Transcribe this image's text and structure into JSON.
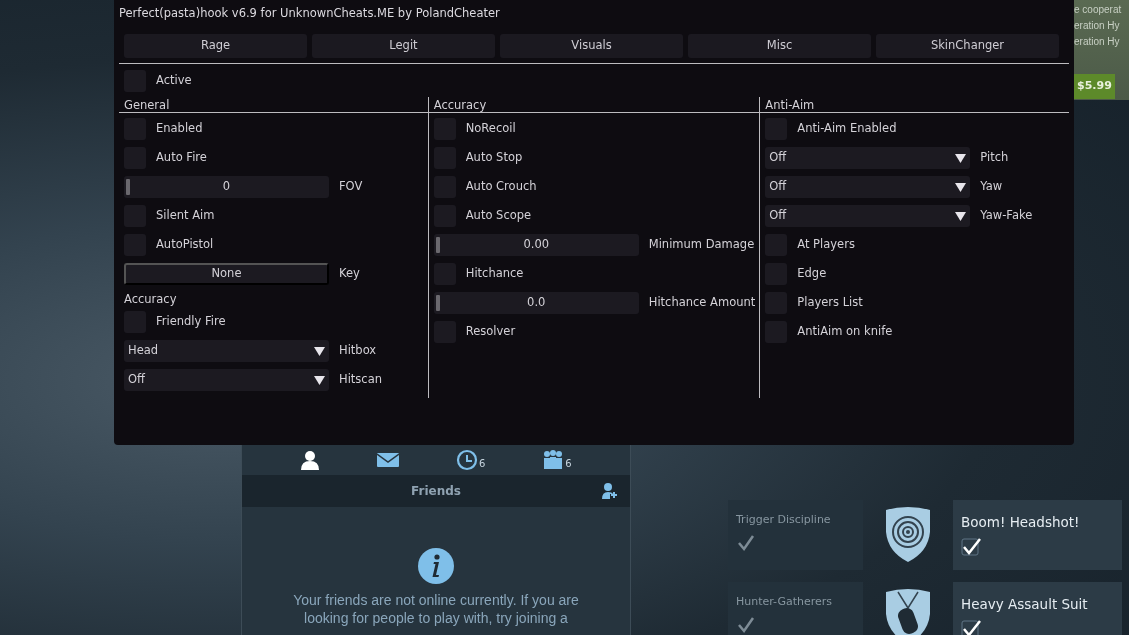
{
  "store": {
    "lines": [
      "e cooperat",
      "eration Hy",
      "eration Hy"
    ],
    "price": "$5.99"
  },
  "friends": {
    "icons": [
      {
        "kind": "person"
      },
      {
        "kind": "mail"
      },
      {
        "kind": "clock",
        "count": "6"
      },
      {
        "kind": "group",
        "count": "6"
      }
    ],
    "heading": "Friends",
    "message": [
      "Your friends are not online currently.  If you are",
      "looking for people to play with, try joining a"
    ]
  },
  "achievements": [
    {
      "title": "Trigger Discipline",
      "kind": "dim"
    },
    {
      "title": "Boom! Headshot!",
      "kind": "bright"
    },
    {
      "title": "Hunter-Gatherers",
      "kind": "dim"
    },
    {
      "title": "Heavy Assault Suit",
      "kind": "bright"
    }
  ],
  "window": {
    "title": "Perfect(pasta)hook v6.9 for UnknownCheats.ME by PolandCheater"
  },
  "tabs": [
    {
      "label": "Rage",
      "selected": false
    },
    {
      "label": "Legit",
      "selected": false
    },
    {
      "label": "Visuals",
      "selected": false
    },
    {
      "label": "Misc",
      "selected": false
    },
    {
      "label": "SkinChanger",
      "selected": false
    }
  ],
  "active": {
    "label": "Active",
    "checked": false
  },
  "columns": [
    {
      "heading": "General",
      "items": [
        {
          "kind": "checkbox",
          "label": "Enabled",
          "checked": false
        },
        {
          "kind": "checkbox",
          "label": "Auto Fire",
          "checked": false
        },
        {
          "kind": "slider",
          "reading": "0",
          "label": "FOV",
          "level": 0
        },
        {
          "kind": "checkbox",
          "label": "Silent Aim",
          "checked": false
        },
        {
          "kind": "checkbox",
          "label": "AutoPistol",
          "checked": false
        },
        {
          "kind": "keybind",
          "key": "None",
          "label": "Key"
        },
        {
          "kind": "subheading",
          "label": "Accuracy"
        },
        {
          "kind": "checkbox",
          "label": "Friendly Fire",
          "checked": false
        },
        {
          "kind": "dropdown",
          "option": "Head",
          "label": "Hitbox"
        },
        {
          "kind": "dropdown",
          "option": "Off",
          "label": "Hitscan"
        }
      ]
    },
    {
      "heading": "Accuracy",
      "items": [
        {
          "kind": "checkbox",
          "label": "NoRecoil",
          "checked": false
        },
        {
          "kind": "checkbox",
          "label": "Auto Stop",
          "checked": false
        },
        {
          "kind": "checkbox",
          "label": "Auto Crouch",
          "checked": false
        },
        {
          "kind": "checkbox",
          "label": "Auto Scope",
          "checked": false
        },
        {
          "kind": "slider",
          "reading": "0.00",
          "label": "Minimum Damage",
          "level": 0
        },
        {
          "kind": "checkbox",
          "label": "Hitchance",
          "checked": false
        },
        {
          "kind": "slider",
          "reading": "0.0",
          "label": "Hitchance Amount",
          "level": 0
        },
        {
          "kind": "checkbox",
          "label": "Resolver",
          "checked": false
        }
      ]
    },
    {
      "heading": "Anti-Aim",
      "items": [
        {
          "kind": "checkbox",
          "label": "Anti-Aim Enabled",
          "checked": false
        },
        {
          "kind": "dropdown",
          "option": "Off",
          "label": "Pitch"
        },
        {
          "kind": "dropdown",
          "option": "Off",
          "label": "Yaw"
        },
        {
          "kind": "dropdown",
          "option": "Off",
          "label": "Yaw-Fake"
        },
        {
          "kind": "checkbox",
          "label": "At Players",
          "checked": false
        },
        {
          "kind": "checkbox",
          "label": "Edge",
          "checked": false
        },
        {
          "kind": "checkbox",
          "label": "Players List",
          "checked": false
        },
        {
          "kind": "checkbox",
          "label": "AntiAim on knife",
          "checked": false
        }
      ]
    }
  ]
}
